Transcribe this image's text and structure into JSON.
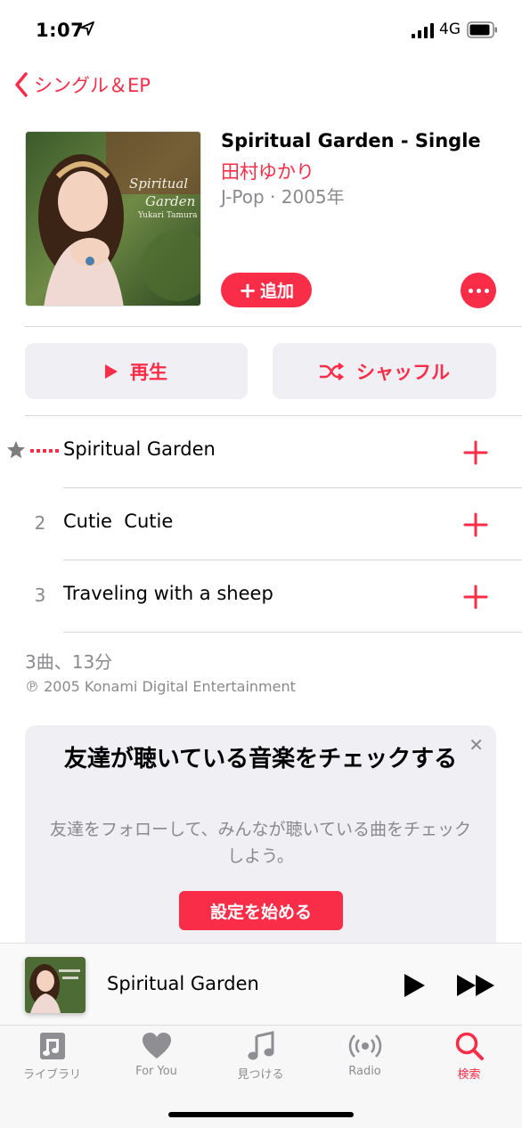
{
  "status_bar": {
    "time": "1:07",
    "network": "4G"
  },
  "nav": {
    "back_label": "シングル＆EP"
  },
  "album": {
    "title": "Spiritual Garden - Single",
    "artist": "田村ゆかり",
    "meta": "J-Pop · 2005年",
    "add_label": "追加",
    "cover_text": {
      "line1": "Spiritual",
      "line2": "Garden",
      "line3": "Yukari Tamura"
    }
  },
  "actions": {
    "play_label": "再生",
    "shuffle_label": "シャッフル"
  },
  "tracks": [
    {
      "number": "",
      "title": "Spiritual Garden",
      "state": "playing"
    },
    {
      "number": "2",
      "title": "Cutie  Cutie"
    },
    {
      "number": "3",
      "title": "Traveling with a sheep"
    }
  ],
  "summary": "3曲、13分",
  "copyright": "℗ 2005 Konami Digital Entertainment",
  "friends_card": {
    "heading": "友達が聴いている音楽をチェックする",
    "body": "友達をフォローして、みんなが聴いている曲をチェックしよう。",
    "cta": "設定を始める",
    "close": "✕"
  },
  "mini_player": {
    "song": "Spiritual Garden"
  },
  "tabs": [
    {
      "label": "ライブラリ",
      "icon": "library-icon"
    },
    {
      "label": "For You",
      "icon": "heart-icon"
    },
    {
      "label": "見つける",
      "icon": "music-note-icon"
    },
    {
      "label": "Radio",
      "icon": "radio-icon"
    },
    {
      "label": "検索",
      "icon": "search-icon",
      "active": true
    }
  ],
  "colors": {
    "accent": "#fa2d48",
    "secondary_text": "#8a8a8e",
    "button_bg": "#efeff4"
  }
}
